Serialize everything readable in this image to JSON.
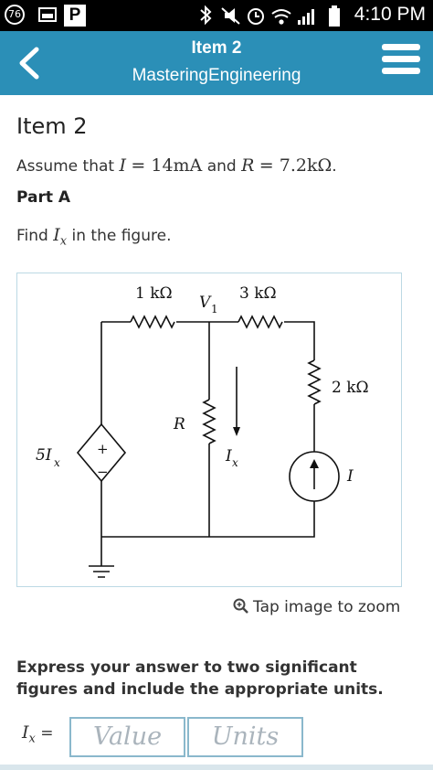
{
  "status_bar": {
    "notification_count": "76",
    "parking_label": "P",
    "time": "4:10 PM"
  },
  "header": {
    "title": "Item 2",
    "subtitle": "MasteringEngineering"
  },
  "content": {
    "item_title": "Item 2",
    "assume_prefix": "Assume that",
    "current_symbol": "I",
    "current_value": "= 14mA",
    "assume_and": "and",
    "resistance_symbol": "R",
    "resistance_value": "= 7.2kΩ",
    "assume_end": ".",
    "part_label": "Part A",
    "find_prefix": "Find",
    "find_symbol": "I",
    "find_sub": "x",
    "find_suffix": "in the figure.",
    "zoom_label": "Tap image to zoom",
    "instructions": "Express your answer to two significant figures and include the appropriate units.",
    "answer_label": "I",
    "answer_label_sub": "x",
    "answer_equals": "=",
    "value_placeholder": "Value",
    "units_placeholder": "Units"
  },
  "figure": {
    "r1_label": "1 kΩ",
    "r2_label": "3 kΩ",
    "r3_label": "2 kΩ",
    "r_label": "R",
    "node_label": "V",
    "node_sub": "1",
    "ix_label": "I",
    "ix_sub": "x",
    "dep_source_label": "5I",
    "dep_source_sub": "x",
    "src_label": "I",
    "plus": "+",
    "minus": "−"
  },
  "colors": {
    "header_bg": "#2b8fb7",
    "input_border": "#8ab8cc",
    "frame_border": "#bcd9e4"
  }
}
